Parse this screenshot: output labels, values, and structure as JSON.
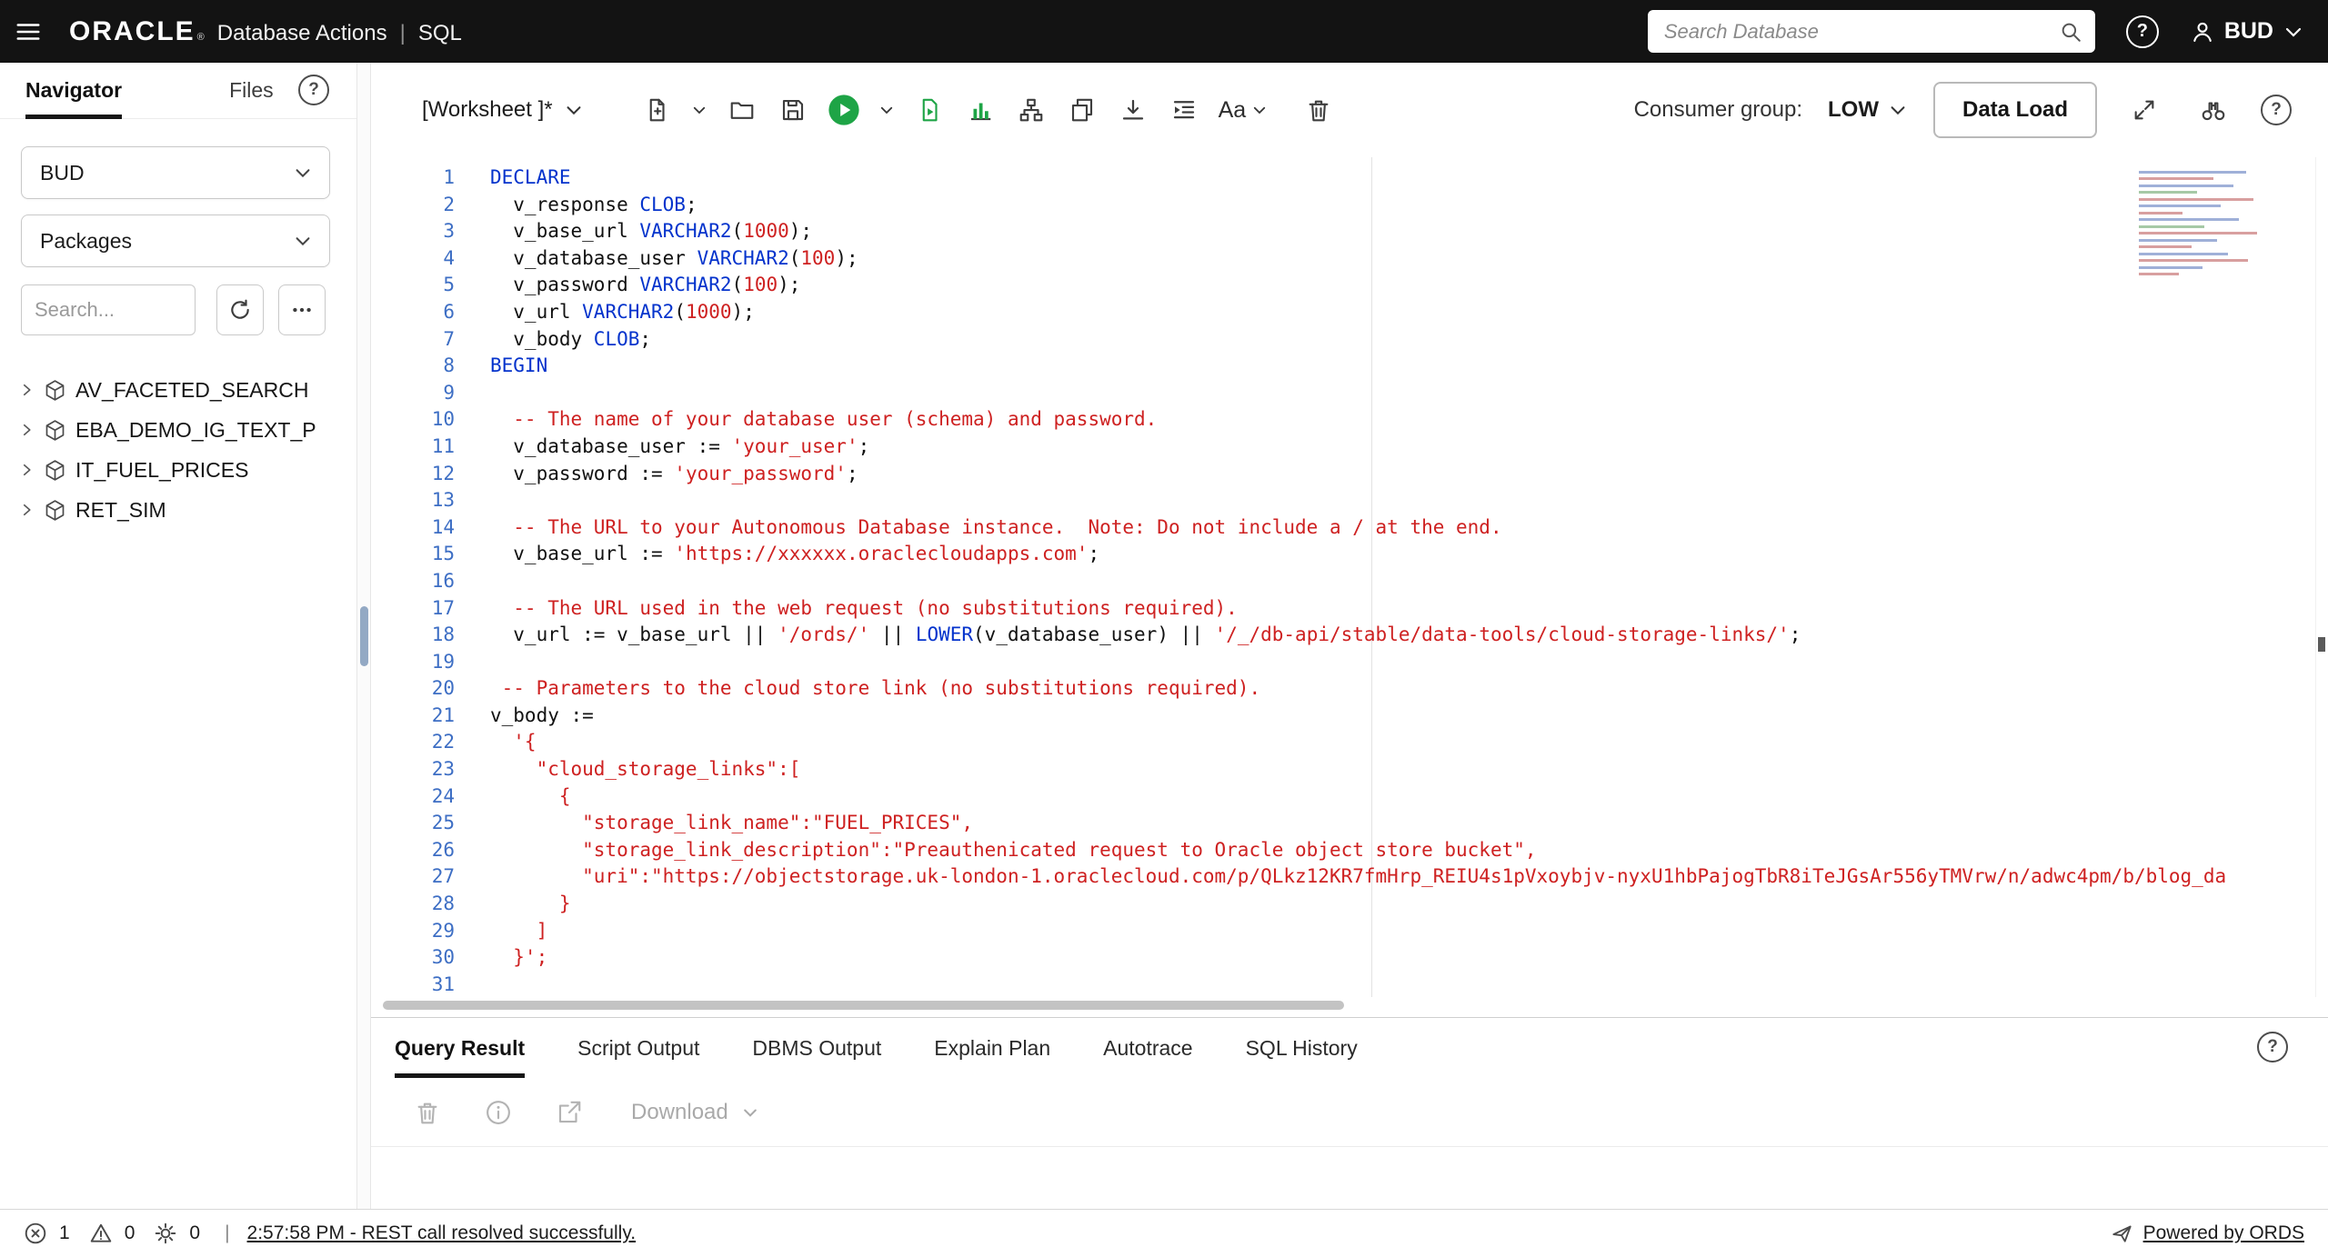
{
  "topbar": {
    "brand": "ORACLE",
    "brand_reg": "®",
    "app_name": "Database Actions",
    "divider": "|",
    "context": "SQL",
    "search_placeholder": "Search Database",
    "user_name": "BUD"
  },
  "sidebar": {
    "tabs": [
      {
        "label": "Navigator",
        "active": true
      },
      {
        "label": "Files",
        "active": false
      }
    ],
    "schema_value": "BUD",
    "object_type_value": "Packages",
    "search_placeholder": "Search...",
    "tree_items": [
      "AV_FACETED_SEARCH",
      "EBA_DEMO_IG_TEXT_P",
      "IT_FUEL_PRICES",
      "RET_SIM"
    ]
  },
  "toolbar": {
    "worksheet_label": "[Worksheet ]*",
    "font_button": "Aa",
    "consumer_group_label": "Consumer group:",
    "consumer_group_value": "LOW",
    "data_load_button": "Data Load"
  },
  "editor": {
    "lines": [
      {
        "seg": [
          [
            "k",
            "DECLARE"
          ]
        ]
      },
      {
        "seg": [
          [
            "p",
            "  v_response "
          ],
          [
            "k",
            "CLOB"
          ],
          [
            "p",
            ";"
          ]
        ]
      },
      {
        "seg": [
          [
            "p",
            "  v_base_url "
          ],
          [
            "k",
            "VARCHAR2"
          ],
          [
            "p",
            "("
          ],
          [
            "n",
            "1000"
          ],
          [
            "p",
            ");"
          ]
        ]
      },
      {
        "seg": [
          [
            "p",
            "  v_database_user "
          ],
          [
            "k",
            "VARCHAR2"
          ],
          [
            "p",
            "("
          ],
          [
            "n",
            "100"
          ],
          [
            "p",
            ");"
          ]
        ]
      },
      {
        "seg": [
          [
            "p",
            "  v_password "
          ],
          [
            "k",
            "VARCHAR2"
          ],
          [
            "p",
            "("
          ],
          [
            "n",
            "100"
          ],
          [
            "p",
            ");"
          ]
        ]
      },
      {
        "seg": [
          [
            "p",
            "  v_url "
          ],
          [
            "k",
            "VARCHAR2"
          ],
          [
            "p",
            "("
          ],
          [
            "n",
            "1000"
          ],
          [
            "p",
            ");"
          ]
        ]
      },
      {
        "seg": [
          [
            "p",
            "  v_body "
          ],
          [
            "k",
            "CLOB"
          ],
          [
            "p",
            ";"
          ]
        ]
      },
      {
        "seg": [
          [
            "k",
            "BEGIN"
          ]
        ]
      },
      {
        "seg": []
      },
      {
        "seg": [
          [
            "c",
            "  -- The name of your database user (schema) and password."
          ]
        ]
      },
      {
        "seg": [
          [
            "p",
            "  v_database_user := "
          ],
          [
            "s",
            "'your_user'"
          ],
          [
            "p",
            ";"
          ]
        ]
      },
      {
        "seg": [
          [
            "p",
            "  v_password := "
          ],
          [
            "s",
            "'your_password'"
          ],
          [
            "p",
            ";"
          ]
        ]
      },
      {
        "seg": []
      },
      {
        "seg": [
          [
            "c",
            "  -- The URL to your Autonomous Database instance.  Note: Do not include a / at the end."
          ]
        ]
      },
      {
        "seg": [
          [
            "p",
            "  v_base_url := "
          ],
          [
            "s",
            "'https://xxxxxx.oraclecloudapps.com'"
          ],
          [
            "p",
            ";"
          ]
        ]
      },
      {
        "seg": []
      },
      {
        "seg": [
          [
            "c",
            "  -- The URL used in the web request (no substitutions required)."
          ]
        ]
      },
      {
        "seg": [
          [
            "p",
            "  v_url := v_base_url || "
          ],
          [
            "s",
            "'/ords/'"
          ],
          [
            "p",
            " || "
          ],
          [
            "k",
            "LOWER"
          ],
          [
            "p",
            "(v_database_user) || "
          ],
          [
            "s",
            "'/_/db-api/stable/data-tools/cloud-storage-links/'"
          ],
          [
            "p",
            ";"
          ]
        ]
      },
      {
        "seg": []
      },
      {
        "seg": [
          [
            "c",
            " -- Parameters to the cloud store link (no substitutions required)."
          ]
        ]
      },
      {
        "seg": [
          [
            "p",
            "v_body :="
          ]
        ]
      },
      {
        "seg": [
          [
            "s",
            "  '{"
          ]
        ]
      },
      {
        "seg": [
          [
            "s",
            "    \"cloud_storage_links\":["
          ]
        ]
      },
      {
        "seg": [
          [
            "s",
            "      {"
          ]
        ]
      },
      {
        "seg": [
          [
            "s",
            "        \"storage_link_name\":\"FUEL_PRICES\","
          ]
        ]
      },
      {
        "seg": [
          [
            "s",
            "        \"storage_link_description\":\"Preauthenicated request to Oracle object store bucket\","
          ]
        ]
      },
      {
        "seg": [
          [
            "s",
            "        \"uri\":\"https://objectstorage.uk-london-1.oraclecloud.com/p/QLkz12KR7fmHrp_REIU4s1pVxoybjv-nyxU1hbPajogTbR8iTeJGsAr556yTMVrw/n/adwc4pm/b/blog_da"
          ]
        ]
      },
      {
        "seg": [
          [
            "s",
            "      }"
          ]
        ]
      },
      {
        "seg": [
          [
            "s",
            "    ]"
          ]
        ]
      },
      {
        "seg": [
          [
            "s",
            "  }';"
          ]
        ]
      },
      {
        "seg": []
      }
    ]
  },
  "results_panel": {
    "tabs": [
      "Query Result",
      "Script Output",
      "DBMS Output",
      "Explain Plan",
      "Autotrace",
      "SQL History"
    ],
    "active_tab": "Query Result",
    "download_button": "Download"
  },
  "statusbar": {
    "error_count": "1",
    "warning_count": "0",
    "process_count": "0",
    "separator": "|",
    "message": "2:57:58 PM - REST call resolved successfully.",
    "powered_by": "Powered by ORDS"
  },
  "colors": {
    "topbar_bg": "#131313",
    "accent_green": "#1ea446",
    "keyword_blue": "#0433cc",
    "literal_red": "#ce2121",
    "line_number_blue": "#3d6ec4"
  }
}
